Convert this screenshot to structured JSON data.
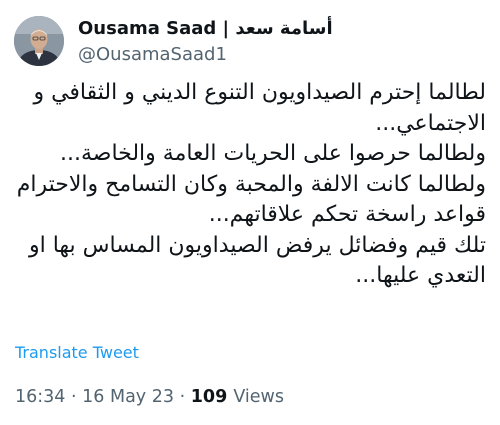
{
  "author": {
    "name": "Ousama Saad | أسامة سعد",
    "handle": "@OusamaSaad1"
  },
  "tweet": {
    "lines": [
      "لطالما إحترم الصيداويون التنوع الديني و الثقافي و",
      "الاجتماعي...",
      "ولطالما حرصوا على الحريات العامة والخاصة...",
      "ولطالما كانت الالفة والمحبة وكان التسامح والاحترام",
      "قواعد راسخة تحكم علاقاتهم...",
      "تلك قيم وفضائل يرفض الصيداويون المساس بها او",
      "التعدي عليها..."
    ],
    "translate_label": "Translate Tweet"
  },
  "meta": {
    "time": "16:34",
    "date": "16 May 23",
    "views_count": "109",
    "views_label": "Views"
  }
}
